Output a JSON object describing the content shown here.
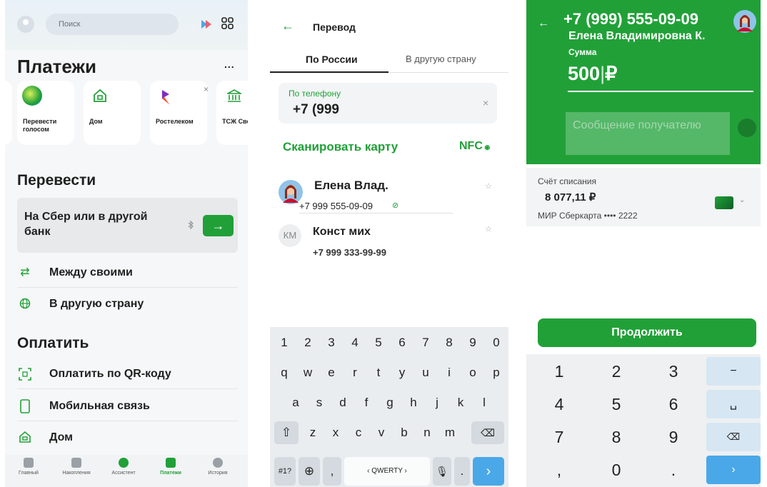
{
  "panel1": {
    "search_placeholder": "Поиск",
    "title": "Платежи",
    "more": "...",
    "tiles": [
      {
        "label": "Перевести голосом"
      },
      {
        "label": "Дом"
      },
      {
        "label": "Ростелеком"
      },
      {
        "label": "ТСЖ Светл"
      }
    ],
    "transfer_title": "Перевести",
    "transfer_button": "На Сбер или в другой банк",
    "arrow": "→",
    "transfer_rows": [
      {
        "label": "Между своими"
      },
      {
        "label": "В другую страну"
      }
    ],
    "pay_title": "Оплатить",
    "pay_rows": [
      {
        "label": "Оплатить по QR-коду"
      },
      {
        "label": "Мобильная связь"
      },
      {
        "label": "Дом"
      }
    ],
    "tabbar": [
      "Главный",
      "Накопления",
      "Ассистент",
      "Платежи",
      "История"
    ]
  },
  "panel2": {
    "back": "←",
    "title": "Перевод",
    "tab_russia": "По России",
    "tab_abroad": "В другую страну",
    "phone_label": "По телефону",
    "phone_value": "+7 (999",
    "clear": "×",
    "scan_card": "Сканировать карту",
    "nfc": "NFC",
    "contacts": [
      {
        "name": "Елена Влад.",
        "phone": "+7 999 555-09-09",
        "initials": ""
      },
      {
        "name": "Конст мих",
        "phone": "+7 999 333-99-99",
        "initials": "КМ"
      }
    ],
    "keyboard": {
      "row_numbers": [
        "1",
        "2",
        "3",
        "4",
        "5",
        "6",
        "7",
        "8",
        "9",
        "0"
      ],
      "row1": [
        "q",
        "w",
        "e",
        "r",
        "t",
        "y",
        "u",
        "i",
        "o",
        "p"
      ],
      "row2": [
        "a",
        "s",
        "d",
        "f",
        "g",
        "h",
        "j",
        "k",
        "l"
      ],
      "row3": [
        "z",
        "x",
        "c",
        "v",
        "b",
        "n",
        "m"
      ],
      "sym": "#1?",
      "comma": ",",
      "space": "‹ QWERTY ›",
      "dot": ".",
      "enter": "›"
    }
  },
  "panel3": {
    "back": "←",
    "phone": "+7 (999) 555-09-09",
    "name": "Елена Владимировна К.",
    "amount_label": "Сумма",
    "amount": "500",
    "currency": "₽",
    "message_placeholder": "Сообщение получателю",
    "account_label": "Счёт списания",
    "balance": "8 077,11 ₽",
    "card": "МИР Сберкарта •••• 2222",
    "continue": "Продолжить",
    "numpad": [
      "1",
      "2",
      "3",
      "4",
      "5",
      "6",
      "7",
      "8",
      "9",
      ",",
      "0",
      "."
    ],
    "side_keys": [
      "−",
      "␣",
      "⌫",
      "›"
    ]
  },
  "colors": {
    "accent": "#21a038",
    "header_green": "#21a038",
    "key_blue": "#d6e6f3"
  }
}
